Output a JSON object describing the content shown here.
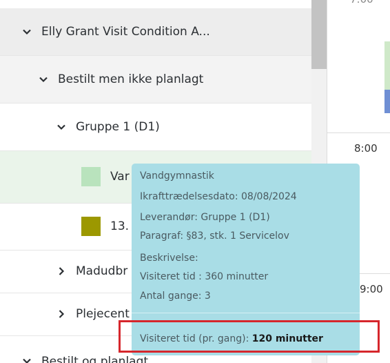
{
  "tree": {
    "rows": [
      {
        "label": "Elly Grant Visit Condition A...",
        "state": "expanded"
      },
      {
        "label": "Bestilt men ikke planlagt",
        "state": "expanded"
      },
      {
        "label": "Gruppe 1 (D1)",
        "state": "expanded"
      },
      {
        "label": "Var",
        "swatch_color": "#b9e3bd"
      },
      {
        "label": "13.",
        "swatch_color": "#9c9800"
      },
      {
        "label": "Madudbr",
        "state": "collapsed"
      },
      {
        "label": "Plejecent",
        "state": "collapsed"
      },
      {
        "label": "Bestilt og planlagt",
        "state": "expanded"
      }
    ]
  },
  "calendar": {
    "times": [
      "7:00",
      "8:00",
      "9:00"
    ]
  },
  "tooltip": {
    "title": "Vandgymnastik",
    "effective_date": "Ikrafttrædelsesdato: 08/08/2024",
    "supplier": "Leverandør: Gruppe 1 (D1)",
    "paragraph": "Paragraf: §83, stk. 1 Servicelov",
    "description_label": "Beskrivelse:",
    "visit_time_total": "Visiteret tid : 360 minutter",
    "count": "Antal gange: 3",
    "per_visit_label": "Visiteret tid (pr. gang):",
    "per_visit_value": "120 minutter"
  },
  "colors": {
    "tooltip_bg": "#a9dde6",
    "highlight": "#d6262c",
    "selected_row": "#eaf4ea"
  }
}
